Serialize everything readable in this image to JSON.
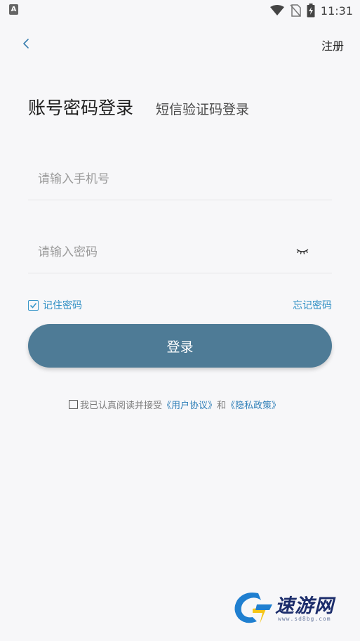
{
  "status_bar": {
    "time": "11:31",
    "left_icon_letter": "A",
    "icons": [
      "wifi-icon",
      "no-sim-icon",
      "battery-charging-icon"
    ]
  },
  "nav": {
    "back_icon": "chevron-left-icon",
    "register_label": "注册"
  },
  "tabs": {
    "active_label": "账号密码登录",
    "inactive_label": "短信验证码登录"
  },
  "form": {
    "phone_placeholder": "请输入手机号",
    "phone_value": "",
    "password_placeholder": "请输入密码",
    "password_value": "",
    "eye_icon": "eye-closed-icon",
    "remember_label": "记住密码",
    "remember_checked": true,
    "forgot_label": "忘记密码",
    "login_label": "登录"
  },
  "agreement": {
    "prefix": "我已认真阅读并接受",
    "user_agreement": "《用户协议》",
    "and": "和",
    "privacy_policy": "《隐私政策》",
    "checked": false
  },
  "watermark": {
    "text": "速游网",
    "url": "www.sd8bg.com"
  },
  "colors": {
    "accent": "#2f8fc4",
    "button": "#4e7b96",
    "background": "#f7f7f9"
  }
}
